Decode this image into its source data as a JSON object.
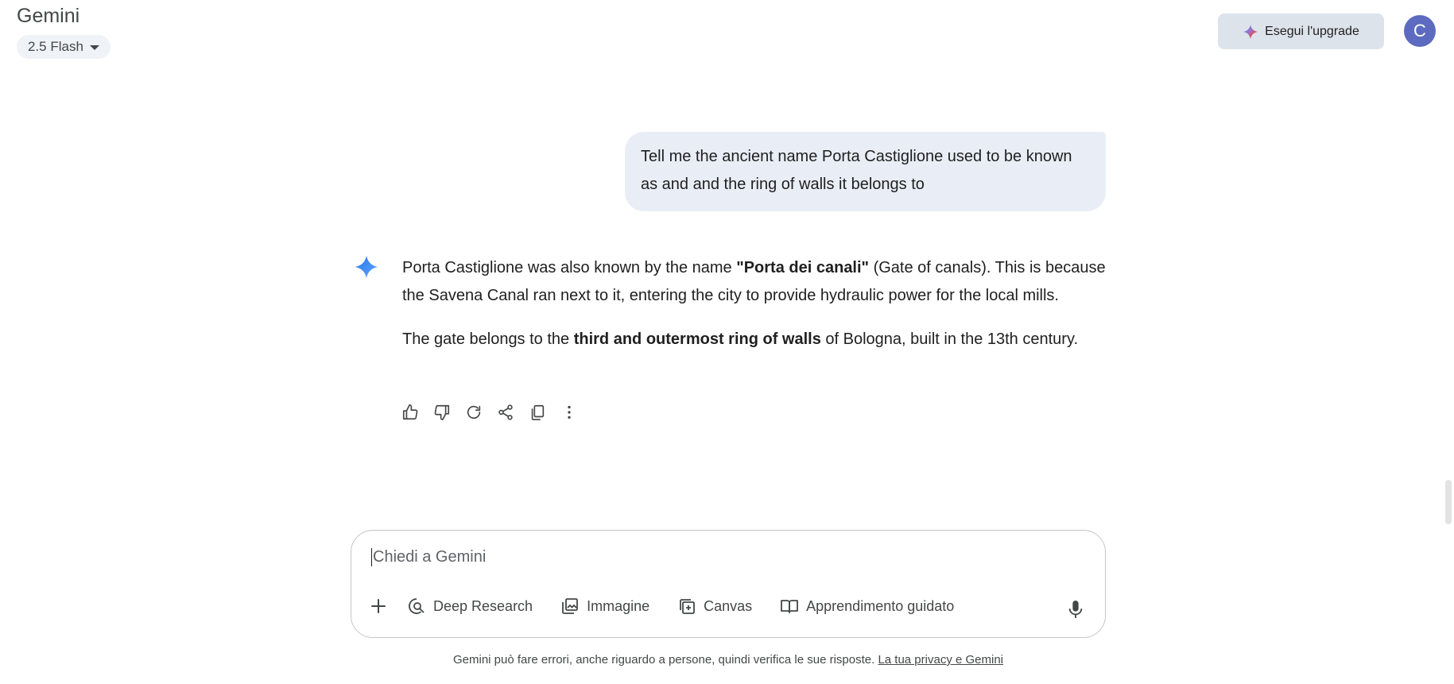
{
  "header": {
    "app_title": "Gemini",
    "model_label": "2.5 Flash",
    "upgrade_label": "Esegui l'upgrade",
    "avatar_initial": "C"
  },
  "conversation": {
    "user_message": "Tell me the ancient name Porta Castiglione used to be known as and and the ring of walls it belongs to",
    "response": {
      "p1_before": "Porta Castiglione was also known by the name ",
      "p1_bold": "\"Porta dei canali\"",
      "p1_after": " (Gate of canals). This is because the Savena Canal ran next to it, entering the city to provide hydraulic power for the local mills.",
      "p2_before": "The gate belongs to the ",
      "p2_bold": "third and outermost ring of walls",
      "p2_after": " of Bologna, built in the 13th century."
    },
    "actions": [
      "thumbs-up-icon",
      "thumbs-down-icon",
      "redo-icon",
      "share-icon",
      "copy-icon",
      "more-vert-icon"
    ]
  },
  "composer": {
    "placeholder": "Chiedi a Gemini",
    "tools": {
      "deep_research": "Deep Research",
      "image": "Immagine",
      "canvas": "Canvas",
      "guided_learning": "Apprendimento guidato"
    }
  },
  "footer": {
    "disclaimer_text": "Gemini può fare errori, anche riguardo a persone, quindi verifica le sue risposte.",
    "privacy_link": "La tua privacy e Gemini"
  },
  "colors": {
    "accent_blue": "#4285f4",
    "user_bubble": "#e9eef6",
    "upgrade_bg": "#dde3ea",
    "avatar_bg": "#5c6bc0"
  }
}
